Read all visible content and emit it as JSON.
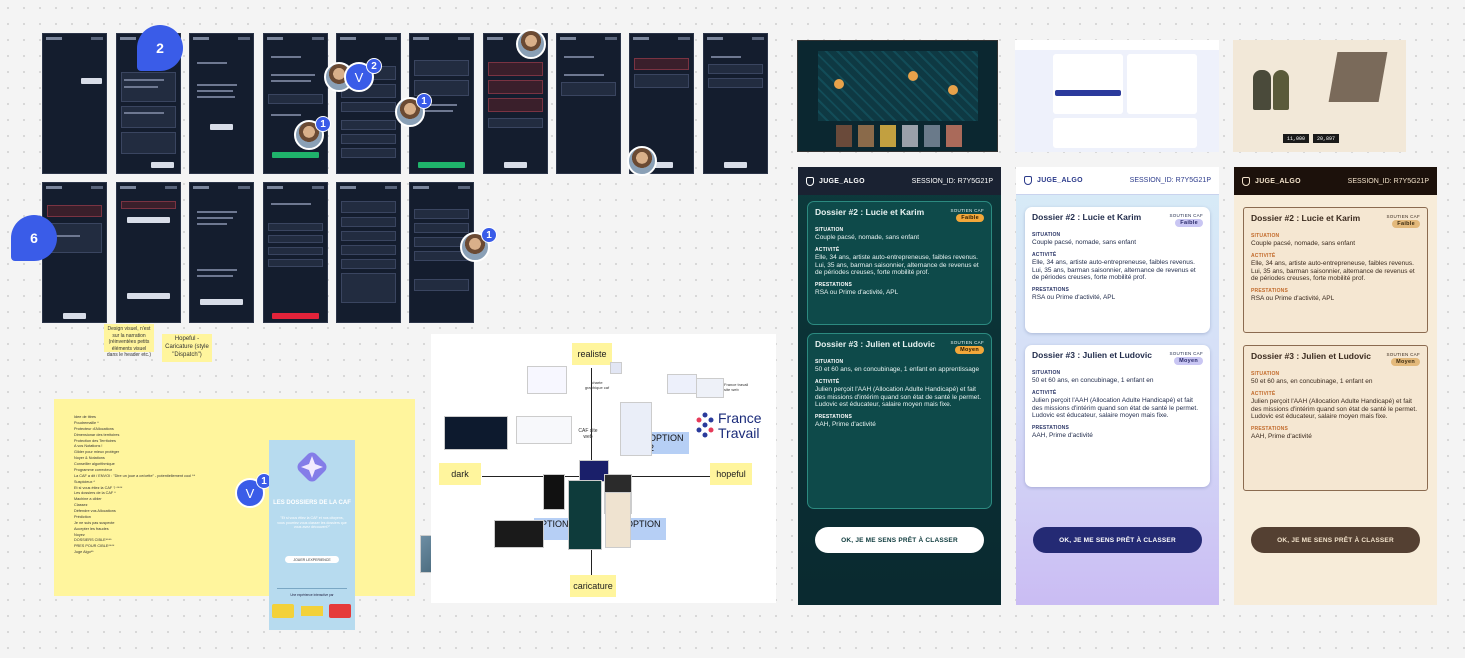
{
  "comments": {
    "bubble_top": "2",
    "bubble_left": "6",
    "badge_one": "1",
    "badge_two": "2",
    "avatar_initial": "V"
  },
  "sticky_notes": {
    "design_note": "Design visuel, n'est sur la narration (réinventées petits éléments visuel dans le header etc.)",
    "hopeful_note": "Hopeful - Caricature (style \"Dispatch\")"
  },
  "notes_list": [
    "Idee de titres",
    "Poudremaille *",
    "Protecteur d'Allocations",
    "Dimensionar des territoires",
    "Protection des Territoires",
    "A vos Notations !",
    "Gilder pour mieux protéger",
    "Noyer & Notations",
    "Conseiller algorithmique",
    "Programme correcteur",
    "La CAF a dit / ENVOI : \"Dire un joue a ce/cette\" - potentiellement cool **",
    "Suspicieux *",
    "Et si vous étiez la CAF ? ****",
    "Les dossiers de la CAF *",
    "Machine a cibler",
    "Classez",
    "Défendre vos Allocations",
    "Prédiction",
    "Je ne suis pas suspecte",
    "Accepter les fraudes",
    "Noyez",
    "DOSSIERS CIBLE****",
    "PRES POUR CIBLE****",
    "Juge Algo**"
  ],
  "poster": {
    "title": "LES DOSSIERS DE LA CAF",
    "quote": "\"Et si vous étiez la CAF et nos citoyens, vous pourriez vous classer les dossiers que vous avez découvert?\"",
    "cta": "JOUER LEXPERIENCE",
    "footer": "Une expérience interactive par"
  },
  "moodboard": {
    "realiste": "realiste",
    "caricature": "caricature",
    "dark": "dark",
    "hopeful": "hopeful",
    "option_1": "OPTION 1",
    "option_2": "OPTION 2",
    "option_3": "OPTION 3",
    "france": "France",
    "travail": "Travail",
    "caf_site": "CAF site web",
    "france_travail_site": "France travail site web",
    "chapitre": "charte graphique caf"
  },
  "illustration": {
    "counter_a": "11,000",
    "counter_b": "20,897"
  },
  "mockups": [
    {
      "app_name": "JUGE_ALGO",
      "session": "SESSION_ID: R7Y5G21P",
      "cards": [
        {
          "title": "Dossier #2 : Lucie et Karim",
          "support_label": "SOUTIEN CAF",
          "level": "Faible",
          "situation_label": "SITUATION",
          "situation": "Couple pacsé, nomade, sans enfant",
          "activite_label": "ACTIVITÉ",
          "activite": "Elle, 34 ans, artiste auto-entrepreneuse, faibles revenus. Lui, 35 ans, barman saisonnier, alternance de revenus et de périodes creuses, forte mobilité prof.",
          "prestations_label": "PRESTATIONS",
          "prestations": "RSA ou Prime d'activité, APL"
        },
        {
          "title": "Dossier #3 : Julien et Ludovic",
          "support_label": "SOUTIEN CAF",
          "level": "Moyen",
          "situation_label": "SITUATION",
          "situation": "50 et 60 ans, en concubinage, 1 enfant en apprentissage",
          "activite_label": "ACTIVITÉ",
          "activite": "Julien perçoit l'AAH (Allocation Adulte Handicapé) et fait des missions d'intérim quand son état de santé le permet. Ludovic est éducateur, salaire moyen mais fixe.",
          "prestations_label": "PRESTATIONS",
          "prestations": "AAH, Prime d'activité"
        }
      ],
      "cta": "OK, JE ME SENS PRÊT À CLASSER"
    },
    {
      "app_name": "JUGE_ALGO",
      "session": "SESSION_ID: R7Y5G21P",
      "cards": [
        {
          "title": "Dossier #2 : Lucie et Karim",
          "support_label": "SOUTIEN CAF",
          "level": "Faible",
          "situation_label": "SITUATION",
          "situation": "Couple pacsé, nomade, sans enfant",
          "activite_label": "ACTIVITÉ",
          "activite": "Elle, 34 ans, artiste auto-entrepreneuse, faibles revenus. Lui, 35 ans, barman saisonnier, alternance de revenus et de périodes creuses, forte mobilité prof.",
          "prestations_label": "PRESTATIONS",
          "prestations": "RSA ou Prime d'activité, APL"
        },
        {
          "title": "Dossier #3 : Julien et Ludovic",
          "support_label": "SOUTIEN CAF",
          "level": "Moyen",
          "situation_label": "SITUATION",
          "situation": "50 et 60 ans, en concubinage, 1 enfant en",
          "activite_label": "ACTIVITÉ",
          "activite": "Julien perçoit l'AAH (Allocation Adulte Handicapé) et fait des missions d'intérim quand son état de santé le permet. Ludovic est éducateur, salaire moyen mais fixe.",
          "prestations_label": "PRESTATIONS",
          "prestations": "AAH, Prime d'activité"
        }
      ],
      "cta": "OK, JE ME SENS PRÊT À CLASSER"
    },
    {
      "app_name": "JUGE_ALGO",
      "session": "SESSION_ID: R7Y5G21P",
      "cards": [
        {
          "title": "Dossier #2 : Lucie et Karim",
          "support_label": "SOUTIEN CAF",
          "level": "Faible",
          "situation_label": "SITUATION",
          "situation": "Couple pacsé, nomade, sans enfant",
          "activite_label": "ACTIVITÉ",
          "activite": "Elle, 34 ans, artiste auto-entrepreneuse, faibles revenus. Lui, 35 ans, barman saisonnier, alternance de revenus et de périodes creuses, forte mobilité prof.",
          "prestations_label": "PRESTATIONS",
          "prestations": "RSA ou Prime d'activité, APL"
        },
        {
          "title": "Dossier #3 : Julien et Ludovic",
          "support_label": "SOUTIEN CAF",
          "level": "Moyen",
          "situation_label": "SITUATION",
          "situation": "50 et 60 ans, en concubinage, 1 enfant en",
          "activite_label": "ACTIVITÉ",
          "activite": "Julien perçoit l'AAH (Allocation Adulte Handicapé) et fait des missions d'intérim quand son état de santé le permet. Ludovic est éducateur, salaire moyen mais fixe.",
          "prestations_label": "PRESTATIONS",
          "prestations": "AAH, Prime d'activité"
        }
      ],
      "cta": "OK, JE ME SENS PRÊT À CLASSER"
    }
  ]
}
